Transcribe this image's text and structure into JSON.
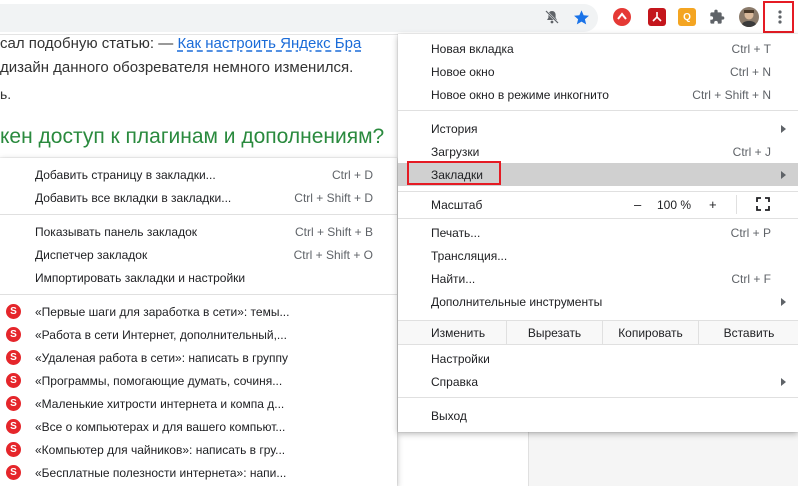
{
  "toolbar": {
    "icons": [
      "notifications-off-icon",
      "bookmark-star-icon",
      "extension-red-circle",
      "extension-pdf",
      "extension-orange",
      "extensions-puzzle-icon",
      "avatar",
      "more-vert-icon"
    ],
    "ext_orange_letter": "Q"
  },
  "article": {
    "line1_text": "сал подобную статью: — ",
    "line1_link": "Как настроить Яндекс Бра",
    "line2": "дизайн данного обозревателя немного изменился.",
    "line3": "ь.",
    "heading": "кен доступ к плагинам и дополнениям?"
  },
  "main_menu": {
    "new_tab": {
      "label": "Новая вкладка",
      "shortcut": "Ctrl + T"
    },
    "new_window": {
      "label": "Новое окно",
      "shortcut": "Ctrl + N"
    },
    "incognito": {
      "label": "Новое окно в режиме инкогнито",
      "shortcut": "Ctrl + Shift + N"
    },
    "history": {
      "label": "История"
    },
    "downloads": {
      "label": "Загрузки",
      "shortcut": "Ctrl + J"
    },
    "bookmarks": {
      "label": "Закладки"
    },
    "zoom": {
      "label": "Масштаб",
      "minus": "–",
      "value": "100 %",
      "plus": "+"
    },
    "print": {
      "label": "Печать...",
      "shortcut": "Ctrl + P"
    },
    "cast": {
      "label": "Трансляция..."
    },
    "find": {
      "label": "Найти...",
      "shortcut": "Ctrl + F"
    },
    "more_tools": {
      "label": "Дополнительные инструменты"
    },
    "edit": {
      "label": "Изменить",
      "cut": "Вырезать",
      "copy": "Копировать",
      "paste": "Вставить"
    },
    "settings": {
      "label": "Настройки"
    },
    "help": {
      "label": "Справка"
    },
    "exit": {
      "label": "Выход"
    }
  },
  "bookmarks_menu": {
    "add_page": {
      "label": "Добавить страницу в закладки...",
      "shortcut": "Ctrl + D"
    },
    "add_all": {
      "label": "Добавить все вкладки в закладки...",
      "shortcut": "Ctrl + Shift + D"
    },
    "show_bar": {
      "label": "Показывать панель закладок",
      "shortcut": "Ctrl + Shift + B"
    },
    "manager": {
      "label": "Диспетчер закладок",
      "shortcut": "Ctrl + Shift + O"
    },
    "import": {
      "label": "Импортировать закладки и настройки"
    },
    "items": [
      "«Первые шаги для заработка в сети»: темы...",
      "«Работа в сети Интернет, дополнительный,...",
      "«Удаленая работа в сети»: написать в группу",
      "«Программы, помогающие думать, сочиня...",
      "«Маленькие хитрости интернета и компа д...",
      "«Все о компьютерах и для вашего компьют...",
      "«Компьютер для чайников»: написать в гру...",
      "«Бесплатные полезности интернета»: напи..."
    ],
    "item_icon_letter": "S"
  }
}
